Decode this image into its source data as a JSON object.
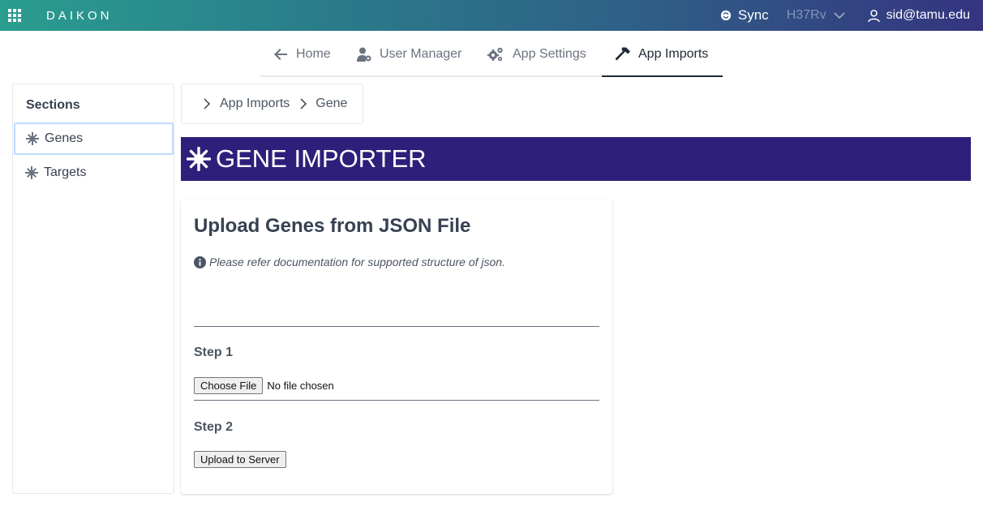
{
  "topbar": {
    "brand": "DAIKON",
    "sync_label": "Sync",
    "strain": "H37Rv",
    "user": "sid@tamu.edu"
  },
  "tabs": [
    {
      "label": "Home",
      "icon": "arrow-left-icon"
    },
    {
      "label": "User Manager",
      "icon": "user-cog-icon"
    },
    {
      "label": "App Settings",
      "icon": "cogs-icon"
    },
    {
      "label": "App Imports",
      "icon": "hammer-icon",
      "active": true
    }
  ],
  "sidebar": {
    "title": "Sections",
    "items": [
      {
        "label": "Genes",
        "icon": "snowflake-icon",
        "selected": true
      },
      {
        "label": "Targets",
        "icon": "snowflake-icon",
        "selected": false
      }
    ]
  },
  "breadcrumb": {
    "items": [
      "App Imports",
      "Gene"
    ]
  },
  "banner": {
    "title": "GENE IMPORTER"
  },
  "card": {
    "title": "Upload Genes from JSON File",
    "info": "Please refer documentation for supported structure of json.",
    "step1_label": "Step 1",
    "choose_file_label": "Choose File",
    "file_status": "No file chosen",
    "step2_label": "Step 2",
    "upload_label": "Upload to Server"
  },
  "colors": {
    "banner": "#2e1f7a",
    "topbar_start": "#2a9d8f",
    "topbar_end": "#35347f"
  }
}
